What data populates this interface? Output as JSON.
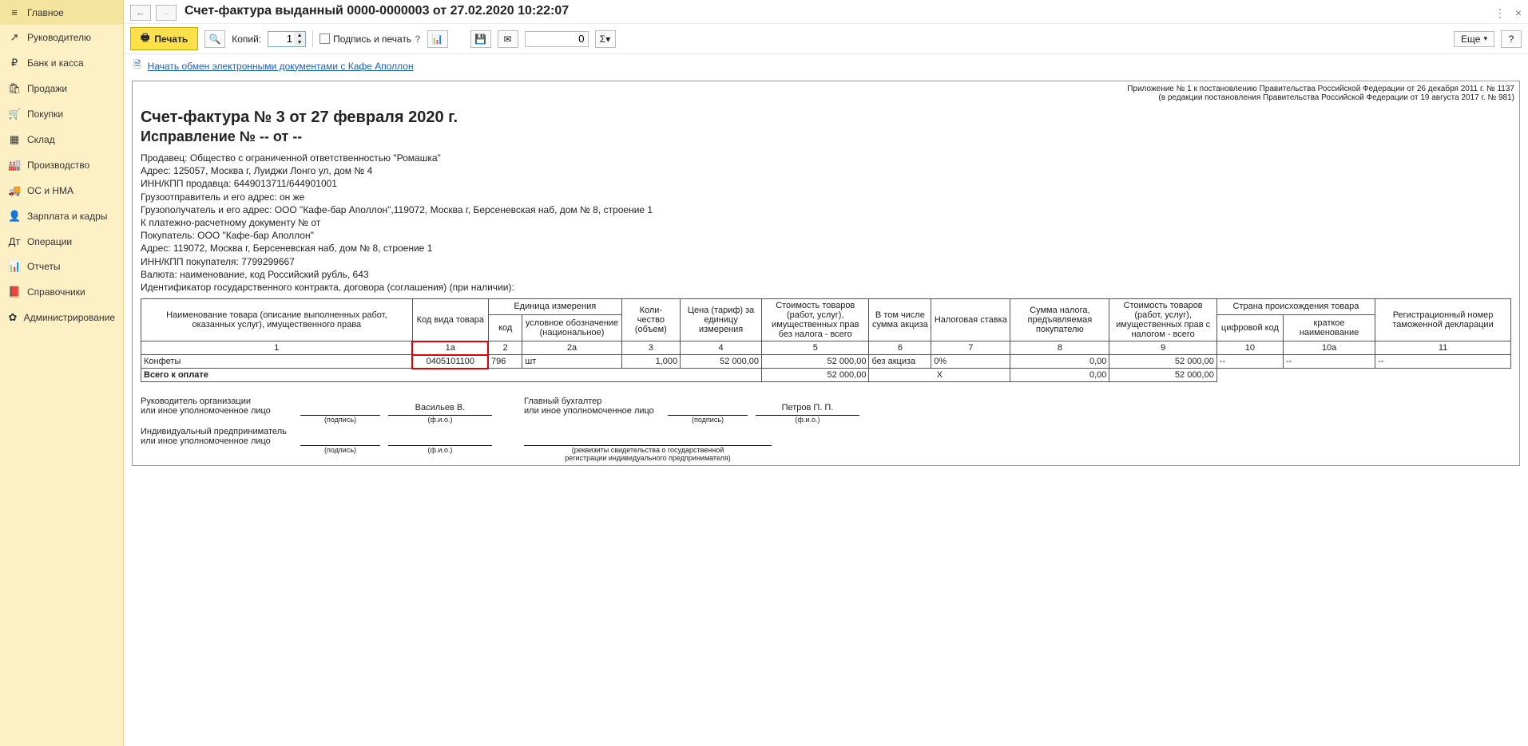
{
  "sidebar": {
    "items": [
      {
        "icon": "≡",
        "label": "Главное"
      },
      {
        "icon": "↗",
        "label": "Руководителю"
      },
      {
        "icon": "₽",
        "label": "Банк и касса"
      },
      {
        "icon": "🛍",
        "label": "Продажи"
      },
      {
        "icon": "🛒",
        "label": "Покупки"
      },
      {
        "icon": "▦",
        "label": "Склад"
      },
      {
        "icon": "🏭",
        "label": "Производство"
      },
      {
        "icon": "🚚",
        "label": "ОС и НМА"
      },
      {
        "icon": "👤",
        "label": "Зарплата и кадры"
      },
      {
        "icon": "Дт",
        "label": "Операции"
      },
      {
        "icon": "📊",
        "label": "Отчеты"
      },
      {
        "icon": "📕",
        "label": "Справочники"
      },
      {
        "icon": "✿",
        "label": "Администрирование"
      }
    ]
  },
  "titlebar": {
    "title": "Счет-фактура выданный 0000-0000003 от 27.02.2020 10:22:07"
  },
  "toolbar": {
    "print": "Печать",
    "copies_label": "Копий:",
    "copies_value": "1",
    "sign_stamp": "Подпись и печать",
    "num_value": "0",
    "more": "Еще"
  },
  "link": {
    "text": "Начать обмен электронными документами с Кафе Аполлон"
  },
  "appendix": {
    "line1": "Приложение № 1 к постановлению Правительства Российской Федерации от 26 декабря 2011 г. № 1137",
    "line2": "(в редакции постановления Правительства Российской Федерации от 19 августа 2017 г. № 981)"
  },
  "doc": {
    "title": "Счет-фактура № 3 от 27 февраля 2020 г.",
    "subtitle": "Исправление № -- от --",
    "lines": [
      "Продавец: Общество с ограниченной ответственностью \"Ромашка\"",
      "Адрес: 125057, Москва г, Луиджи Лонго ул, дом № 4",
      "ИНН/КПП продавца: 6449013711/644901001",
      "Грузоотправитель и его адрес: он же",
      "Грузополучатель и его адрес: ООО \"Кафе-бар Аполлон\",119072, Москва г, Берсеневская наб, дом № 8, строение 1",
      "К платежно-расчетному документу №     от",
      "Покупатель: ООО \"Кафе-бар Аполлон\"",
      "Адрес: 119072, Москва г, Берсеневская наб, дом № 8, строение 1",
      "ИНН/КПП покупателя: 7799299667",
      "Валюта: наименование, код Российский рубль, 643",
      "Идентификатор государственного контракта, договора (соглашения) (при наличии):"
    ]
  },
  "table": {
    "headers": {
      "name": "Наименование товара (описание выполненных работ, оказанных услуг), имущественного права",
      "code": "Код вида товара",
      "unit": "Единица измерения",
      "unit_code": "код",
      "unit_desc": "условное обозначение (национальное)",
      "qty": "Коли-\nчество (объем)",
      "price": "Цена (тариф) за единицу измерения",
      "cost_wo_tax": "Стоимость товаров (работ, услуг), имущественных прав без налога - всего",
      "excise": "В том числе сумма акциза",
      "tax_rate": "Налоговая ставка",
      "tax_sum": "Сумма налога, предъявляемая покупателю",
      "cost_w_tax": "Стоимость товаров (работ, услуг), имущественных прав с налогом - всего",
      "country": "Страна происхождения товара",
      "country_code": "цифровой код",
      "country_name": "краткое наименование",
      "declaration": "Регистрационный номер таможенной декларации"
    },
    "colnums": [
      "1",
      "1а",
      "2",
      "2а",
      "3",
      "4",
      "5",
      "6",
      "7",
      "8",
      "9",
      "10",
      "10а",
      "11"
    ],
    "row": {
      "name": "Конфеты",
      "code": "0405101100",
      "unit_code": "796",
      "unit_desc": "шт",
      "qty": "1,000",
      "price": "52 000,00",
      "cost_wo_tax": "52 000,00",
      "excise": "без акциза",
      "tax_rate": "0%",
      "tax_sum": "0,00",
      "cost_w_tax": "52 000,00",
      "cc": "--",
      "cn": "--",
      "decl": "--"
    },
    "total_label": "Всего к оплате",
    "total": {
      "cost_wo_tax": "52 000,00",
      "excise": "Х",
      "tax_sum": "0,00",
      "cost_w_tax": "52 000,00"
    }
  },
  "signs": {
    "org_head": "Руководитель организации\nили иное уполномоченное лицо",
    "chief_acc": "Главный бухгалтер\nили иное уполномоченное лицо",
    "ip": "Индивидуальный предприниматель\nили иное уполномоченное лицо",
    "sig": "(подпись)",
    "fio": "(ф.и.о.)",
    "rekv": "(реквизиты свидетельства о государственной\nрегистрации индивидуального предпринимателя)",
    "name1": "Васильев В.",
    "name2": "Петров П. П."
  }
}
